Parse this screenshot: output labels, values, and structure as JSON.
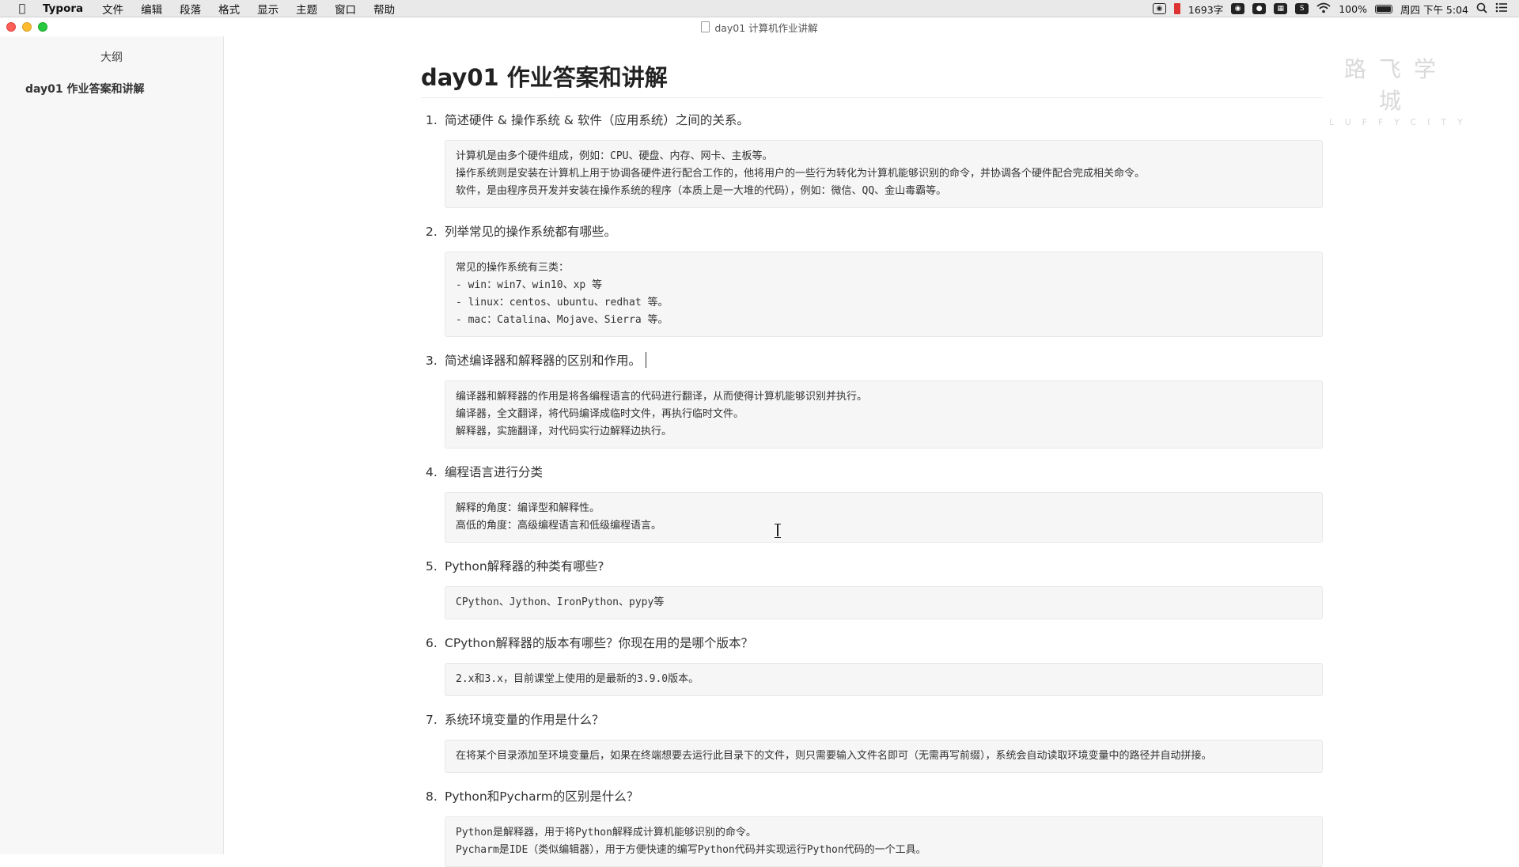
{
  "menubar": {
    "app_name": "Typora",
    "menus": [
      "文件",
      "编辑",
      "段落",
      "格式",
      "显示",
      "主题",
      "窗口",
      "帮助"
    ],
    "word_count": "1693字",
    "battery": "100%",
    "datetime": "周四 下午 5:04"
  },
  "window": {
    "title": "day01 计算机作业讲解"
  },
  "sidebar": {
    "title": "大纲",
    "items": [
      {
        "label": "day01 作业答案和讲解"
      }
    ]
  },
  "watermark": {
    "cn": "路飞学城",
    "en": "LUFFYCITY"
  },
  "document": {
    "title": "day01 作业答案和讲解",
    "questions": [
      {
        "num": "1.",
        "text": "简述硬件 & 操作系统 & 软件（应用系统）之间的关系。",
        "answer": [
          "计算机是由多个硬件组成，例如：CPU、硬盘、内存、网卡、主板等。",
          "操作系统则是安装在计算机上用于协调各硬件进行配合工作的，他将用户的一些行为转化为计算机能够识别的命令，并协调各个硬件配合完成相关命令。",
          "软件，是由程序员开发并安装在操作系统的程序（本质上是一大堆的代码），例如：微信、QQ、金山毒霸等。"
        ]
      },
      {
        "num": "2.",
        "text": "列举常见的操作系统都有哪些。",
        "answer": [
          "常见的操作系统有三类：",
          "- win：win7、win10、xp 等",
          "- linux：centos、ubuntu、redhat 等。",
          "- mac：Catalina、Mojave、Sierra 等。"
        ]
      },
      {
        "num": "3.",
        "text": "简述编译器和解释器的区别和作用。",
        "answer": [
          "编译器和解释器的作用是将各编程语言的代码进行翻译，从而使得计算机能够识别并执行。",
          "编译器，全文翻译，将代码编译成临时文件，再执行临时文件。",
          "解释器，实施翻译，对代码实行边解释边执行。"
        ]
      },
      {
        "num": "4.",
        "text": "编程语言进行分类",
        "answer": [
          "解释的角度：编译型和解释性。",
          "高低的角度：高级编程语言和低级编程语言。"
        ]
      },
      {
        "num": "5.",
        "text": "Python解释器的种类有哪些?",
        "answer": [
          "CPython、Jython、IronPython、pypy等"
        ]
      },
      {
        "num": "6.",
        "text": "CPython解释器的版本有哪些？你现在用的是哪个版本？",
        "answer": [
          "2.x和3.x，目前课堂上使用的是最新的3.9.0版本。"
        ]
      },
      {
        "num": "7.",
        "text": "系统环境变量的作用是什么？",
        "answer": [
          "在将某个目录添加至环境变量后，如果在终端想要去运行此目录下的文件，则只需要输入文件名即可（无需再写前缀），系统会自动读取环境变量中的路径并自动拼接。"
        ]
      },
      {
        "num": "8.",
        "text": "Python和Pycharm的区别是什么？",
        "answer": [
          "Python是解释器，用于将Python解释成计算机能够识别的命令。",
          "Pycharm是IDE（类似编辑器），用于方便快速的编写Python代码并实现运行Python代码的一个工具。"
        ]
      }
    ]
  }
}
